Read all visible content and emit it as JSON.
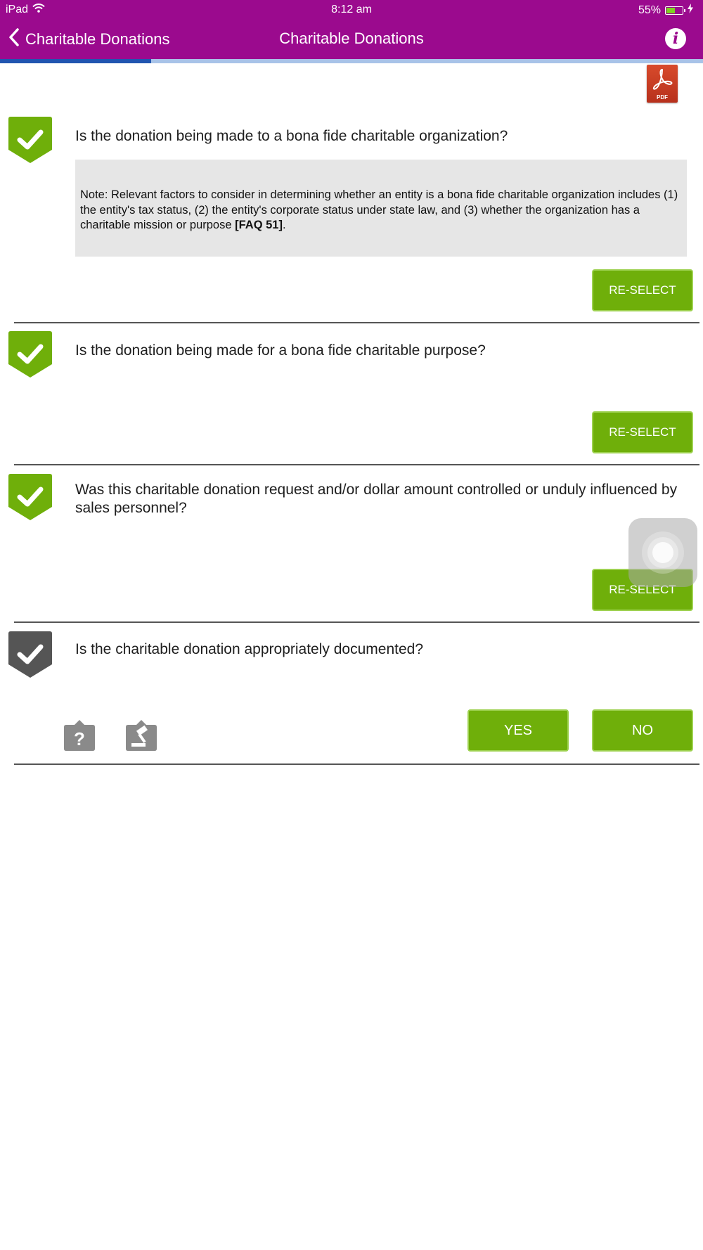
{
  "status_bar": {
    "device": "iPad",
    "time": "8:12 am",
    "battery": "55%",
    "battery_level": 0.55
  },
  "nav": {
    "back_label": "Charitable Donations",
    "title": "Charitable Donations",
    "info_icon": "info-icon",
    "info_glyph": "i"
  },
  "progress": {
    "fraction": 0.215
  },
  "pdf": {
    "icon": "pdf-icon",
    "label": "PDF"
  },
  "questions": [
    {
      "text": "Is the donation being made to a bona fide charitable organization?",
      "state": "answered",
      "note_text": "Note: Relevant factors to consider in determining whether an entity is a bona fide charitable organization includes (1) the entity's tax status, (2) the entity's corporate status under state law, and (3) whether the organization has a charitable mission or purpose ",
      "note_ref": "[FAQ 51]",
      "note_end": ".",
      "reselect_label": "RE-SELECT"
    },
    {
      "text": "Is the donation being made for a bona fide charitable purpose?",
      "state": "answered",
      "reselect_label": "RE-SELECT"
    },
    {
      "text": "Was this charitable donation request and/or dollar amount controlled or unduly influenced by sales personnel?",
      "state": "answered",
      "reselect_label": "RE-SELECT"
    },
    {
      "text": "Is the charitable donation appropriately documented?",
      "state": "pending",
      "yes_label": "YES",
      "no_label": "NO",
      "help_icon": "help-question-icon",
      "help_glyph": "?",
      "law_icon": "gavel-icon"
    }
  ],
  "colors": {
    "brand": "#9b0a8e",
    "button_green": "#6faf0a",
    "check_green": "#6faf0a",
    "check_gray": "#555555",
    "progress_fill": "#2155b0",
    "progress_track": "#a8c3e8"
  }
}
